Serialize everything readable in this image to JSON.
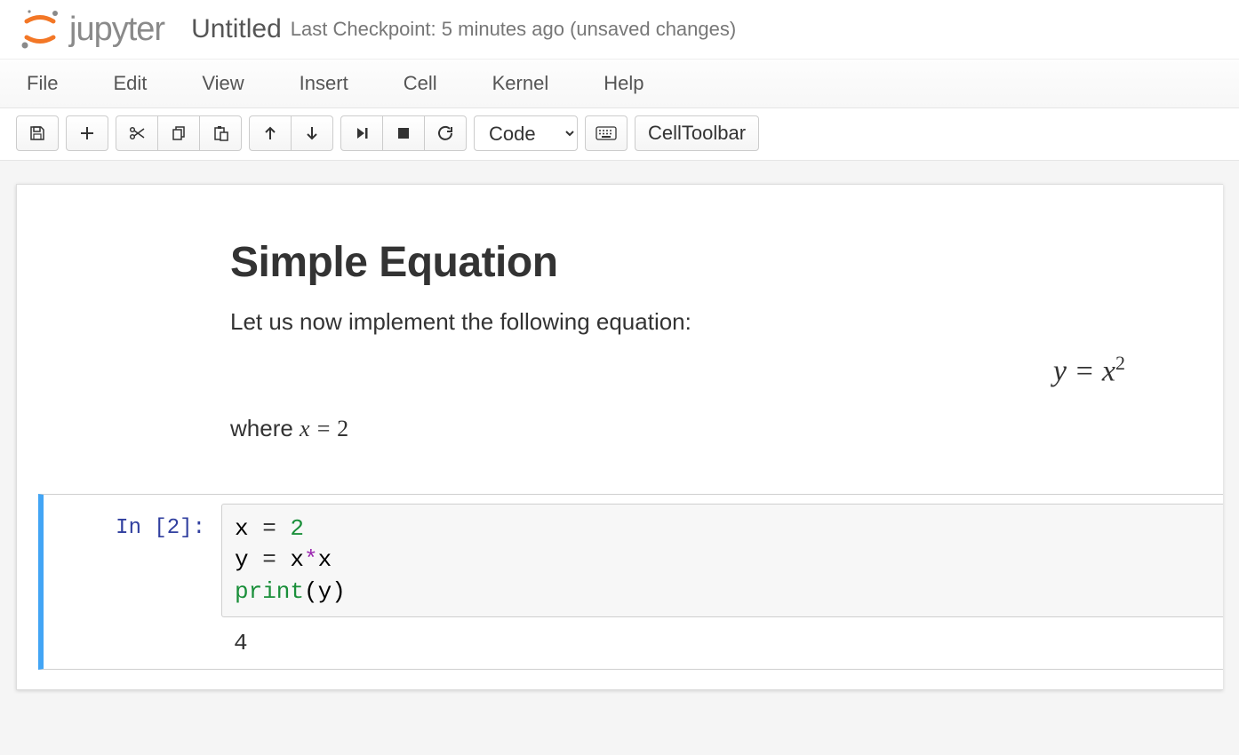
{
  "header": {
    "logo_text": "jupyter",
    "notebook_name": "Untitled",
    "checkpoint": "Last Checkpoint: 5 minutes ago (unsaved changes)"
  },
  "menubar": {
    "items": [
      "File",
      "Edit",
      "View",
      "Insert",
      "Cell",
      "Kernel",
      "Help"
    ]
  },
  "toolbar": {
    "save_icon": "save-icon",
    "add_icon": "plus-icon",
    "cut_icon": "scissors-icon",
    "copy_icon": "copy-icon",
    "paste_icon": "paste-icon",
    "up_icon": "arrow-up-icon",
    "down_icon": "arrow-down-icon",
    "run_icon": "run-icon",
    "stop_icon": "stop-icon",
    "restart_icon": "restart-icon",
    "celltype_selected": "Code",
    "keyboard_icon": "keyboard-icon",
    "celltoolbar_label": "CellToolbar"
  },
  "notebook": {
    "markdown": {
      "heading": "Simple Equation",
      "intro": "Let us now implement the following equation:",
      "equation_lhs": "y",
      "equation_eq": " = ",
      "equation_rhs_base": "x",
      "equation_rhs_exp": "2",
      "where_pre": "where ",
      "where_var": "x",
      "where_eq": " = ",
      "where_val": "2"
    },
    "code_cell": {
      "prompt": "In [2]:",
      "code": {
        "line1_lhs": "x",
        "line1_eq": " = ",
        "line1_val": "2",
        "line2_lhs": "y",
        "line2_eq": " = ",
        "line2_a": "x",
        "line2_op": "*",
        "line2_b": "x",
        "line3_fn": "print",
        "line3_open": "(",
        "line3_arg": "y",
        "line3_close": ")"
      },
      "output": "4"
    }
  }
}
